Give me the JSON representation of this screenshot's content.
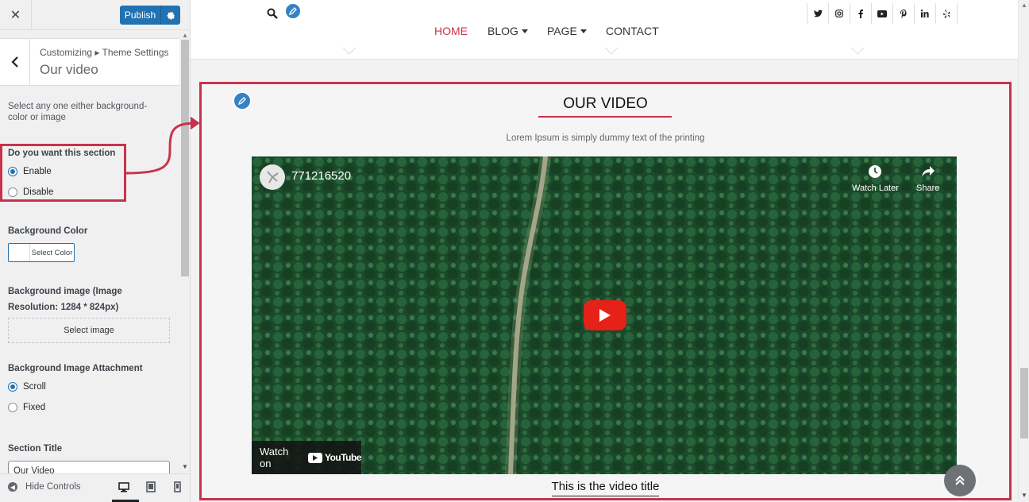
{
  "sidebar": {
    "close_icon": "close-icon",
    "publish_label": "Publish",
    "breadcrumb": "Customizing ▸ Theme Settings",
    "section_title": "Our video",
    "description": "Select any one either background-color or image",
    "show_section": {
      "label": "Do you want this section",
      "options": [
        "Enable",
        "Disable"
      ],
      "selected": "Enable"
    },
    "background_color": {
      "label": "Background Color",
      "button": "Select Color"
    },
    "background_image": {
      "label": "Background image (Image Resolution: 1284 * 824px)",
      "button": "Select image"
    },
    "attachment": {
      "label": "Background Image Attachment",
      "options": [
        "Scroll",
        "Fixed"
      ],
      "selected": "Scroll"
    },
    "section_title_field": {
      "label": "Section Title",
      "value": "Our Video"
    },
    "footer": {
      "hide_controls": "Hide Controls",
      "devices": [
        "desktop",
        "tablet",
        "mobile"
      ],
      "active_device": "desktop"
    }
  },
  "preview": {
    "nav": [
      {
        "label": "HOME",
        "active": true,
        "dropdown": false
      },
      {
        "label": "BLOG",
        "active": false,
        "dropdown": true
      },
      {
        "label": "PAGE",
        "active": false,
        "dropdown": true
      },
      {
        "label": "CONTACT",
        "active": false,
        "dropdown": false
      }
    ],
    "social_icons": [
      "twitter-icon",
      "instagram-icon",
      "facebook-icon",
      "youtube-icon",
      "pinterest-icon",
      "linkedin-icon",
      "yelp-icon"
    ],
    "video_section": {
      "title": "OUR VIDEO",
      "subtitle": "Lorem Ipsum is simply dummy text of the printing",
      "video_id": "771216520",
      "watch_later": "Watch Later",
      "share": "Share",
      "watch_on": "Watch on",
      "youtube_brand": "YouTube",
      "caption": "This is the video title"
    }
  },
  "colors": {
    "accent": "#c8334b",
    "wp_blue": "#2271b1",
    "nav_active": "#c8334b"
  }
}
